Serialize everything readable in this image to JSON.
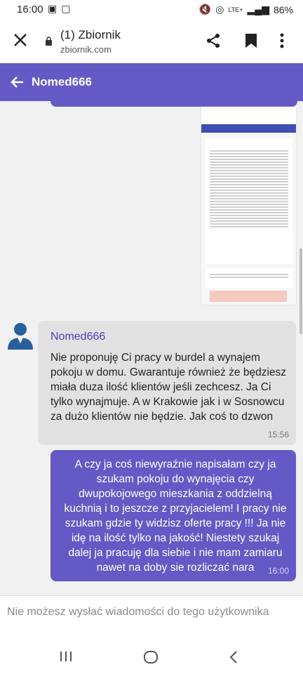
{
  "statusbar": {
    "time": "16:00",
    "battery": "86%",
    "network": "LTE+"
  },
  "urlbar": {
    "title": "(1) Zbiornik",
    "url": "zbiornik.com"
  },
  "header": {
    "name": "Nomed666"
  },
  "messages": [
    {
      "sender": "Nomed666",
      "text": "Nie proponuję Ci pracy w burdel a wynajem pokoju w domu. Gwarantuje również że będziesz miała duza ilość klientów jeśli zechcesz. Ja Ci tylko wynajmuje. A w Krakowie jak i w Sosnowcu za dużo klientów nie będzie. Jak coś to dzwon",
      "time": "15:56"
    },
    {
      "text": "A czy ja coś niewyraźnie napisałam czy ja szukam pokoju do wynajęcia czy dwupokojowego mieszkania z oddzielną kuchnią i to jeszcze z przyjacielem! I pracy nie szukam gdzie ty widzisz oferte pracy !!! Ja nie idę na ilość tylko na jakość! Niestety szukaj dalej ja pracuję dla siebie i nie mam zamiaru nawet na doby sie rozliczać nara",
      "time": "16:00"
    }
  ],
  "footer": {
    "notice": "Nie możesz wysłać wiadomości do tego użytkownika"
  },
  "colors": {
    "accent": "#6459c5",
    "incoming_bubble": "#e1e1e1",
    "background": "#f1f1f1"
  }
}
